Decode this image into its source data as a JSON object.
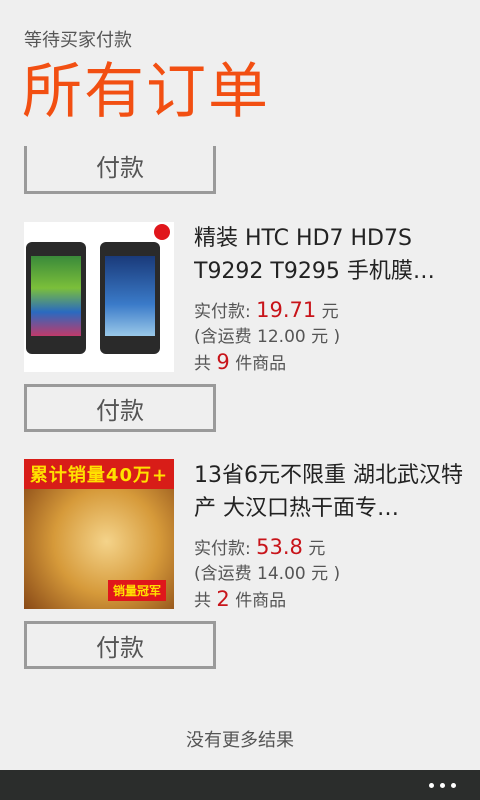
{
  "header": {
    "subtitle": "等待买家付款",
    "title": "所有订单"
  },
  "pay_label": "付款",
  "orders": [
    {
      "title": "精装 HTC HD7 HD7S T9292 T9295 手机膜…",
      "paid_label": "实付款:",
      "paid_amount": "19.71",
      "currency": "元",
      "shipping_text": "(含运费  12.00  元 )",
      "count_prefix": "共",
      "count": "9",
      "count_suffix": "件商品",
      "image_icon": "phone-product-image"
    },
    {
      "title": "13省6元不限重 湖北武汉特产 大汉口热干面专…",
      "paid_label": "实付款:",
      "paid_amount": "53.8",
      "currency": "元",
      "shipping_text": "(含运费  14.00  元 )",
      "count_prefix": "共",
      "count": "2",
      "count_suffix": "件商品",
      "image_icon": "noodle-product-image"
    }
  ],
  "footer": {
    "no_more": "没有更多结果"
  },
  "colors": {
    "accent": "#f24f12",
    "price_red": "#c8141a",
    "app_bar": "#2b2d2c"
  }
}
